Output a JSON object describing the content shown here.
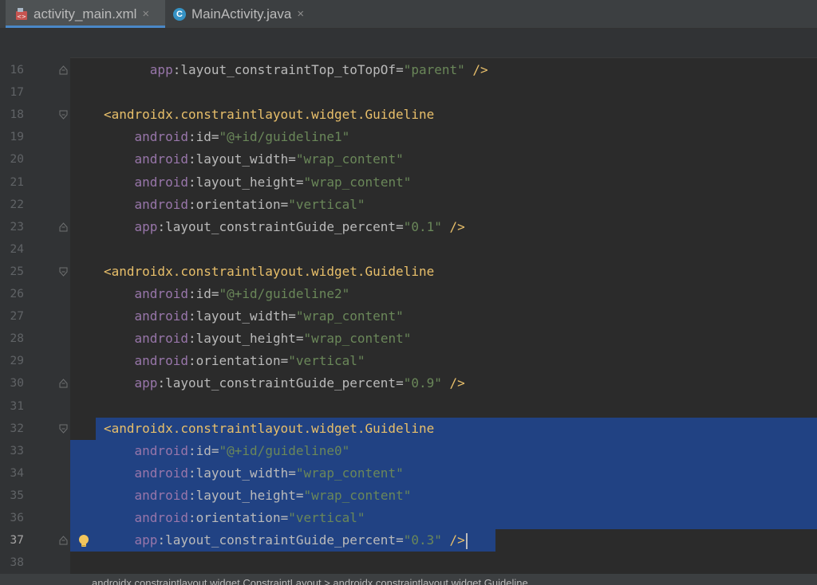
{
  "tabs": [
    {
      "label": "activity_main.xml",
      "icon": "xml-layout-icon",
      "active": true
    },
    {
      "label": "MainActivity.java",
      "icon": "java-class-icon",
      "active": false
    }
  ],
  "close_glyph": "×",
  "lines": [
    {
      "num": "16",
      "tokens": [
        [
          "      ",
          ""
        ],
        [
          "app",
          "ns"
        ],
        [
          ":",
          "attr"
        ],
        [
          "layout_constraintTop_toTopOf",
          "attr"
        ],
        [
          "=",
          "attr"
        ],
        [
          "\"parent\"",
          "str"
        ],
        [
          " />",
          "tag"
        ]
      ]
    },
    {
      "num": "17",
      "tokens": []
    },
    {
      "num": "18",
      "tokens": [
        [
          "<androidx.constraintlayout.widget.Guideline",
          "tag"
        ]
      ]
    },
    {
      "num": "19",
      "tokens": [
        [
          "    ",
          ""
        ],
        [
          "android",
          "ns"
        ],
        [
          ":",
          "attr"
        ],
        [
          "id",
          "attr"
        ],
        [
          "=",
          "attr"
        ],
        [
          "\"@+id/guideline1\"",
          "str"
        ]
      ]
    },
    {
      "num": "20",
      "tokens": [
        [
          "    ",
          ""
        ],
        [
          "android",
          "ns"
        ],
        [
          ":",
          "attr"
        ],
        [
          "layout_width",
          "attr"
        ],
        [
          "=",
          "attr"
        ],
        [
          "\"wrap_content\"",
          "str"
        ]
      ]
    },
    {
      "num": "21",
      "tokens": [
        [
          "    ",
          ""
        ],
        [
          "android",
          "ns"
        ],
        [
          ":",
          "attr"
        ],
        [
          "layout_height",
          "attr"
        ],
        [
          "=",
          "attr"
        ],
        [
          "\"wrap_content\"",
          "str"
        ]
      ]
    },
    {
      "num": "22",
      "tokens": [
        [
          "    ",
          ""
        ],
        [
          "android",
          "ns"
        ],
        [
          ":",
          "attr"
        ],
        [
          "orientation",
          "attr"
        ],
        [
          "=",
          "attr"
        ],
        [
          "\"vertical\"",
          "str"
        ]
      ]
    },
    {
      "num": "23",
      "tokens": [
        [
          "    ",
          ""
        ],
        [
          "app",
          "ns"
        ],
        [
          ":",
          "attr"
        ],
        [
          "layout_constraintGuide_percent",
          "attr"
        ],
        [
          "=",
          "attr"
        ],
        [
          "\"0.1\"",
          "str"
        ],
        [
          " />",
          "tag"
        ]
      ]
    },
    {
      "num": "24",
      "tokens": []
    },
    {
      "num": "25",
      "tokens": [
        [
          "<androidx.constraintlayout.widget.Guideline",
          "tag"
        ]
      ]
    },
    {
      "num": "26",
      "tokens": [
        [
          "    ",
          ""
        ],
        [
          "android",
          "ns"
        ],
        [
          ":",
          "attr"
        ],
        [
          "id",
          "attr"
        ],
        [
          "=",
          "attr"
        ],
        [
          "\"@+id/guideline2\"",
          "str"
        ]
      ]
    },
    {
      "num": "27",
      "tokens": [
        [
          "    ",
          ""
        ],
        [
          "android",
          "ns"
        ],
        [
          ":",
          "attr"
        ],
        [
          "layout_width",
          "attr"
        ],
        [
          "=",
          "attr"
        ],
        [
          "\"wrap_content\"",
          "str"
        ]
      ]
    },
    {
      "num": "28",
      "tokens": [
        [
          "    ",
          ""
        ],
        [
          "android",
          "ns"
        ],
        [
          ":",
          "attr"
        ],
        [
          "layout_height",
          "attr"
        ],
        [
          "=",
          "attr"
        ],
        [
          "\"wrap_content\"",
          "str"
        ]
      ]
    },
    {
      "num": "29",
      "tokens": [
        [
          "    ",
          ""
        ],
        [
          "android",
          "ns"
        ],
        [
          ":",
          "attr"
        ],
        [
          "orientation",
          "attr"
        ],
        [
          "=",
          "attr"
        ],
        [
          "\"vertical\"",
          "str"
        ]
      ]
    },
    {
      "num": "30",
      "tokens": [
        [
          "    ",
          ""
        ],
        [
          "app",
          "ns"
        ],
        [
          ":",
          "attr"
        ],
        [
          "layout_constraintGuide_percent",
          "attr"
        ],
        [
          "=",
          "attr"
        ],
        [
          "\"0.9\"",
          "str"
        ],
        [
          " />",
          "tag"
        ]
      ]
    },
    {
      "num": "31",
      "tokens": []
    },
    {
      "num": "32",
      "tokens": [
        [
          "<androidx.constraintlayout.widget.Guideline",
          "tag"
        ]
      ]
    },
    {
      "num": "33",
      "tokens": [
        [
          "    ",
          ""
        ],
        [
          "android",
          "ns"
        ],
        [
          ":",
          "attr"
        ],
        [
          "id",
          "attr"
        ],
        [
          "=",
          "attr"
        ],
        [
          "\"@+id/guideline0\"",
          "str"
        ]
      ]
    },
    {
      "num": "34",
      "tokens": [
        [
          "    ",
          ""
        ],
        [
          "android",
          "ns"
        ],
        [
          ":",
          "attr"
        ],
        [
          "layout_width",
          "attr"
        ],
        [
          "=",
          "attr"
        ],
        [
          "\"wrap_content\"",
          "str"
        ]
      ]
    },
    {
      "num": "35",
      "tokens": [
        [
          "    ",
          ""
        ],
        [
          "android",
          "ns"
        ],
        [
          ":",
          "attr"
        ],
        [
          "layout_height",
          "attr"
        ],
        [
          "=",
          "attr"
        ],
        [
          "\"wrap_content\"",
          "str"
        ]
      ]
    },
    {
      "num": "36",
      "tokens": [
        [
          "    ",
          ""
        ],
        [
          "android",
          "ns"
        ],
        [
          ":",
          "attr"
        ],
        [
          "orientation",
          "attr"
        ],
        [
          "=",
          "attr"
        ],
        [
          "\"vertical\"",
          "str"
        ]
      ]
    },
    {
      "num": "37",
      "tokens": [
        [
          "    ",
          ""
        ],
        [
          "app",
          "ns"
        ],
        [
          ":",
          "attr"
        ],
        [
          "layout_constraintGuide_percent",
          "attr"
        ],
        [
          "=",
          "attr"
        ],
        [
          "\"0.3\"",
          "str"
        ],
        [
          " />",
          "tag"
        ]
      ],
      "current": true
    },
    {
      "num": "38",
      "tokens": []
    }
  ],
  "status_text": "androidx.constraintlayout.widget.ConstraintLayout > androidx.constraintlayout.widget.Guideline",
  "colors": {
    "background": "#2b2b2b",
    "selection": "#214283",
    "tag": "#e8bf6a",
    "namespace": "#9876aa",
    "string": "#6a8759",
    "attribute": "#bababa",
    "tab_underline": "#4a88c7"
  }
}
